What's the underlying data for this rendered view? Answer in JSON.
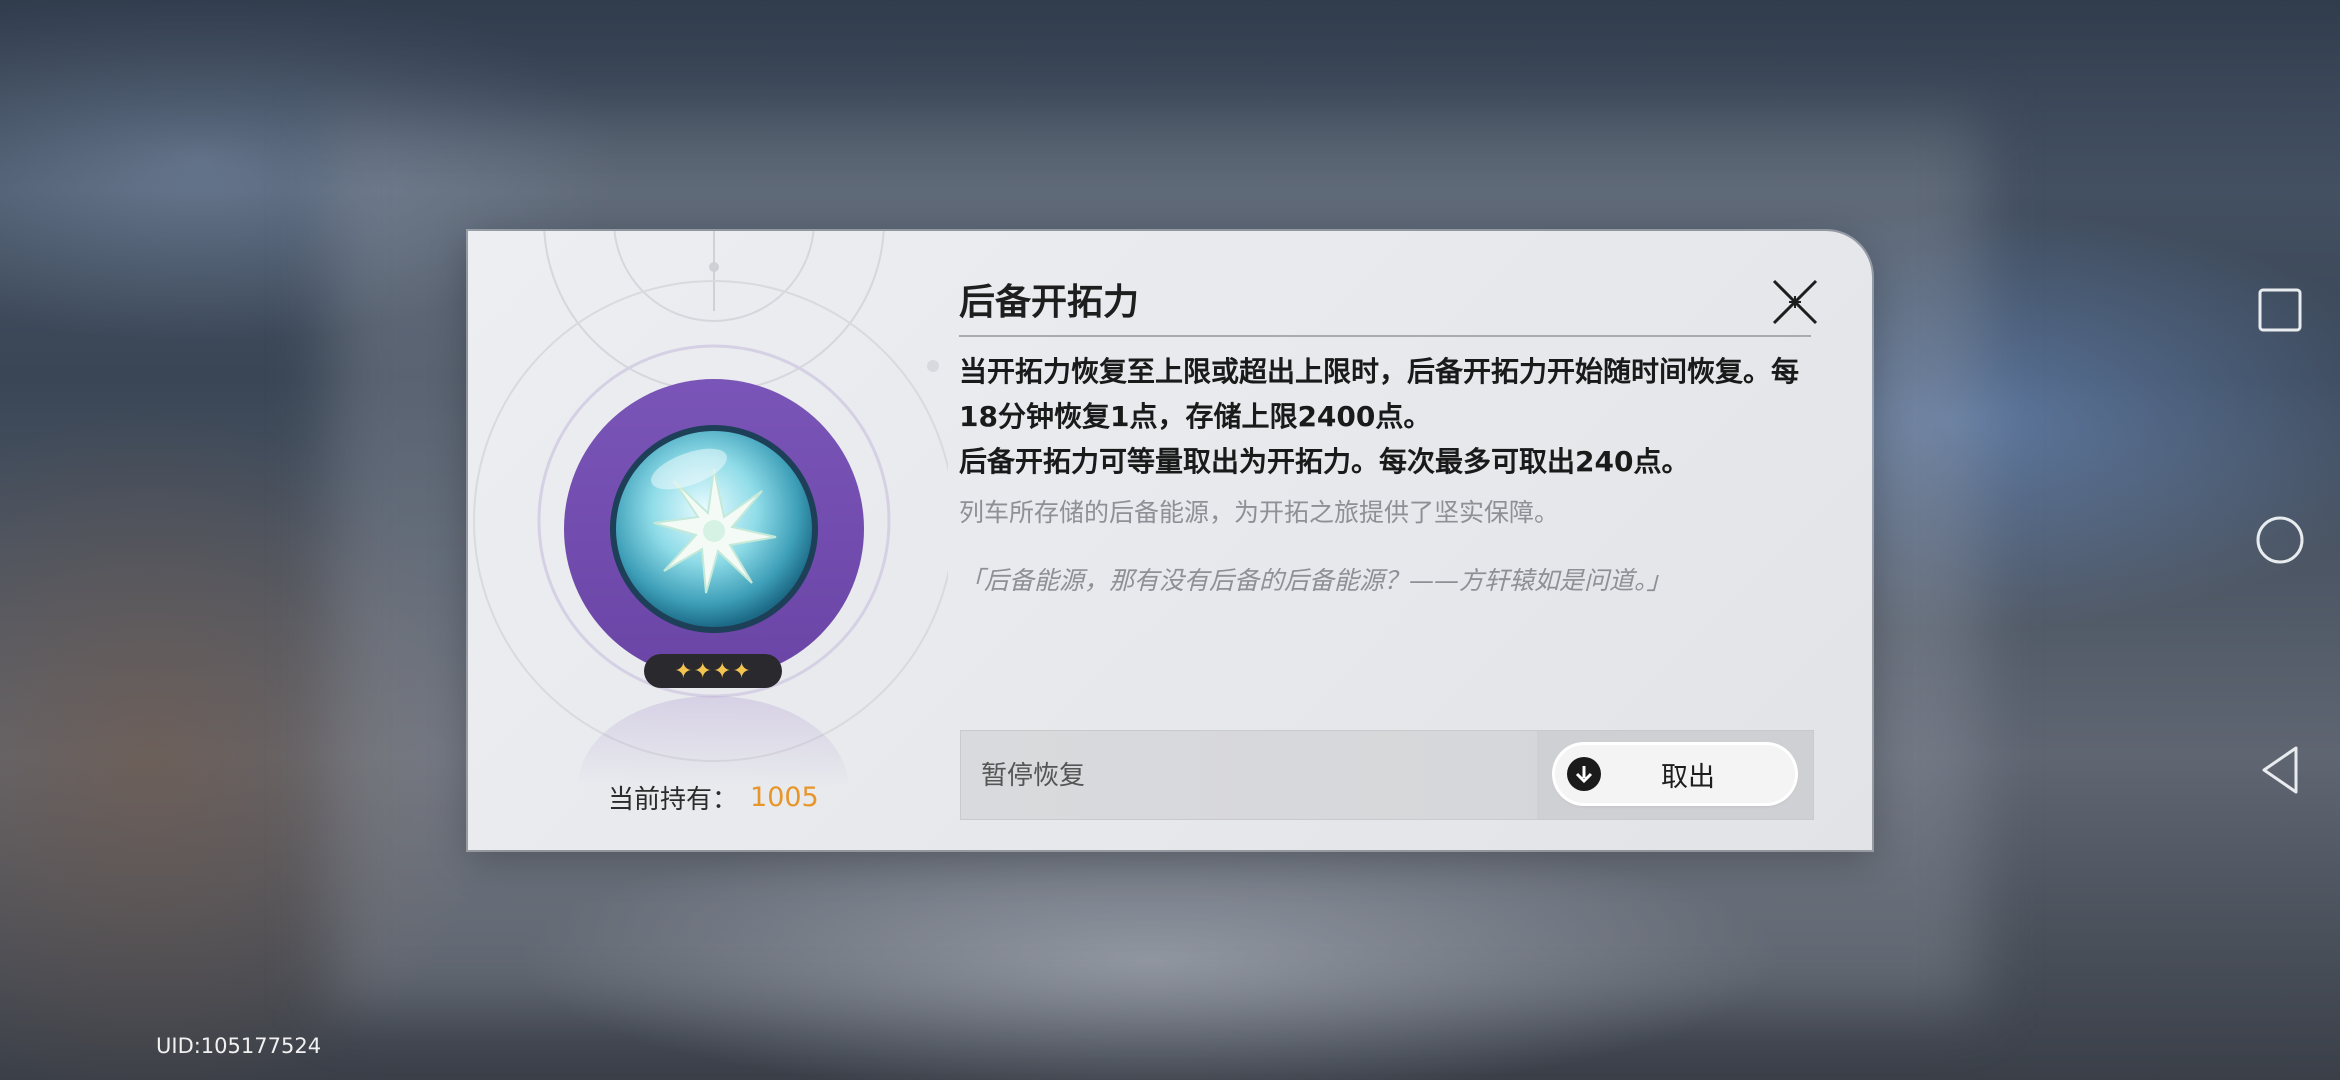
{
  "dialog": {
    "title": "后备开拓力",
    "description_line1": "当开拓力恢复至上限或超出上限时，后备开拓力开始随时间恢复。每18分钟恢复1点，存储上限2400点。",
    "description_line2": "后备开拓力可等量取出为开拓力。每次最多可取出240点。",
    "flavor_text": "列车所存储的后备能源，为开拓之旅提供了坚实保障。",
    "quote": "「后备能源，那有没有后备的后备能源？——方轩辕如是问道。」",
    "holding_label": "当前持有：",
    "holding_count": "1005",
    "rarity_stars": "✦✦✦✦",
    "status_label": "暂停恢复",
    "withdraw_label": "取出"
  },
  "uid_text": "UID:105177524",
  "colors": {
    "accent_orange": "#e7962a",
    "badge_purple": "#7a55b8",
    "star_gold": "#f4c451"
  },
  "icons": {
    "close": "close-icon",
    "withdraw": "download-arrow-icon",
    "nav_square": "recent-apps-icon",
    "nav_circle": "home-icon",
    "nav_triangle": "back-icon"
  }
}
